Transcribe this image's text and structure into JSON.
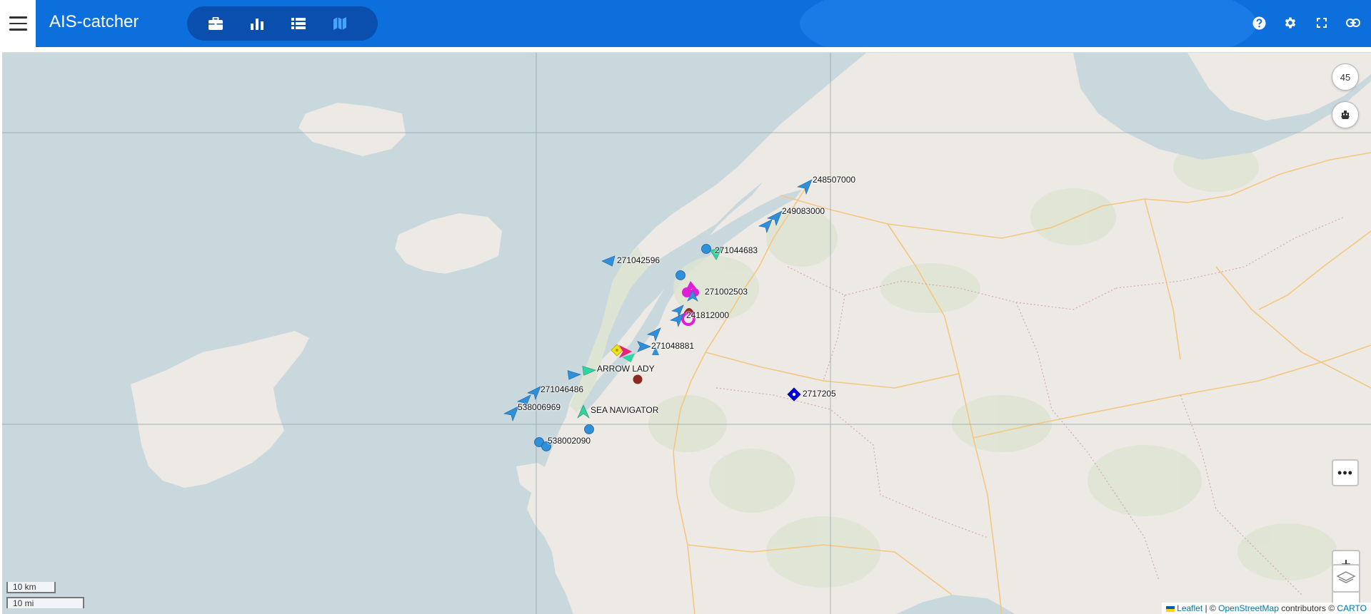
{
  "app": {
    "title": "AIS-catcher"
  },
  "header": {
    "tabs": [
      {
        "name": "briefcase-icon",
        "label": "Dashboard"
      },
      {
        "name": "bar-chart-icon",
        "label": "Statistics"
      },
      {
        "name": "list-icon",
        "label": "Ships"
      },
      {
        "name": "map-icon",
        "label": "Map",
        "active": true
      }
    ],
    "icons": [
      "help-icon",
      "gear-icon",
      "fullscreen-icon",
      "link-icon"
    ],
    "colors": {
      "bar": "#0d6fdc",
      "pill": "#0a4fae",
      "active_tab": "#46a3ff"
    }
  },
  "map": {
    "ship_count": "45",
    "vessels": [
      {
        "label": "248507000",
        "color": "#2f8fd8",
        "shape": "arrow"
      },
      {
        "label": "249083000",
        "color": "#2f8fd8",
        "shape": "arrow"
      },
      {
        "label": "271044683",
        "color": "#2f8fd8",
        "shape": "arrow"
      },
      {
        "label": "271042596",
        "color": "#2f8fd8",
        "shape": "arrow"
      },
      {
        "label": "271002503",
        "color": "#e11ed7",
        "shape": "circle"
      },
      {
        "label": "241812000",
        "color": "#2f8fd8",
        "shape": "arrow"
      },
      {
        "label": "271048881",
        "color": "#2f8fd8",
        "shape": "arrow"
      },
      {
        "label": "ARROW LADY",
        "color": "#2fd5a0",
        "shape": "arrow"
      },
      {
        "label": "271046486",
        "color": "#2f8fd8",
        "shape": "arrow"
      },
      {
        "label": "538006969",
        "color": "#2f8fd8",
        "shape": "arrow"
      },
      {
        "label": "SEA NAVIGATOR",
        "color": "#2fd5a0",
        "shape": "arrow"
      },
      {
        "label": "538002090",
        "color": "#2f8fd8",
        "shape": "circle"
      },
      {
        "label": "2717205",
        "color": "#0000dd",
        "shape": "diamond"
      }
    ],
    "controls": {
      "more_label": "•••",
      "zoom_in": "+",
      "zoom_out": "−"
    },
    "scale": {
      "metric": "10 km",
      "imperial": "10 mi"
    },
    "attribution": {
      "leaflet": "Leaflet",
      "sep1": " | © ",
      "osm": "OpenStreetMap",
      "mid": " contributors © ",
      "carto": "CARTO"
    }
  }
}
